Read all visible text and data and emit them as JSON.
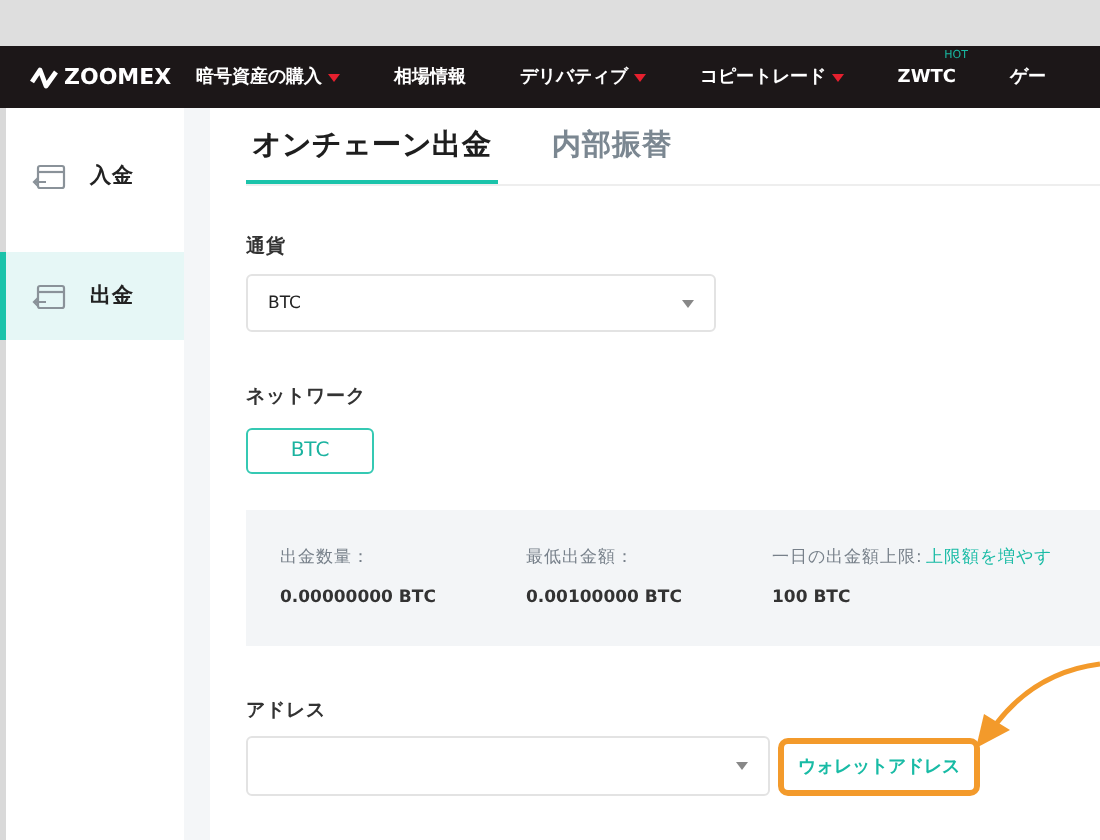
{
  "header": {
    "logo": "ZOOMEX",
    "nav": [
      {
        "label": "暗号資産の購入",
        "dropdown": true
      },
      {
        "label": "相場情報",
        "dropdown": false
      },
      {
        "label": "デリバティブ",
        "dropdown": true
      },
      {
        "label": "コピートレード",
        "dropdown": true
      },
      {
        "label": "ZWTC",
        "dropdown": false,
        "badge": "HOT"
      },
      {
        "label": "ゲー",
        "dropdown": false
      }
    ]
  },
  "sidebar": {
    "items": [
      {
        "label": "入金",
        "selected": false
      },
      {
        "label": "出金",
        "selected": true
      }
    ]
  },
  "tabs": [
    {
      "label": "オンチェーン出金",
      "selected": true
    },
    {
      "label": "内部振替",
      "selected": false
    }
  ],
  "currency": {
    "label": "通貨",
    "value": "BTC"
  },
  "network": {
    "label": "ネットワーク",
    "options": [
      {
        "label": "BTC",
        "selected": true
      }
    ]
  },
  "info": {
    "columns": [
      {
        "label": "出金数量：",
        "value": "0.00000000 BTC"
      },
      {
        "label": "最低出金額：",
        "value": "0.00100000 BTC"
      },
      {
        "label": "一日の出金額上限:",
        "link": "上限額を増やす",
        "value": "100 BTC"
      }
    ]
  },
  "address": {
    "label": "アドレス",
    "link": "ウォレットアドレス",
    "highlighted": true
  }
}
